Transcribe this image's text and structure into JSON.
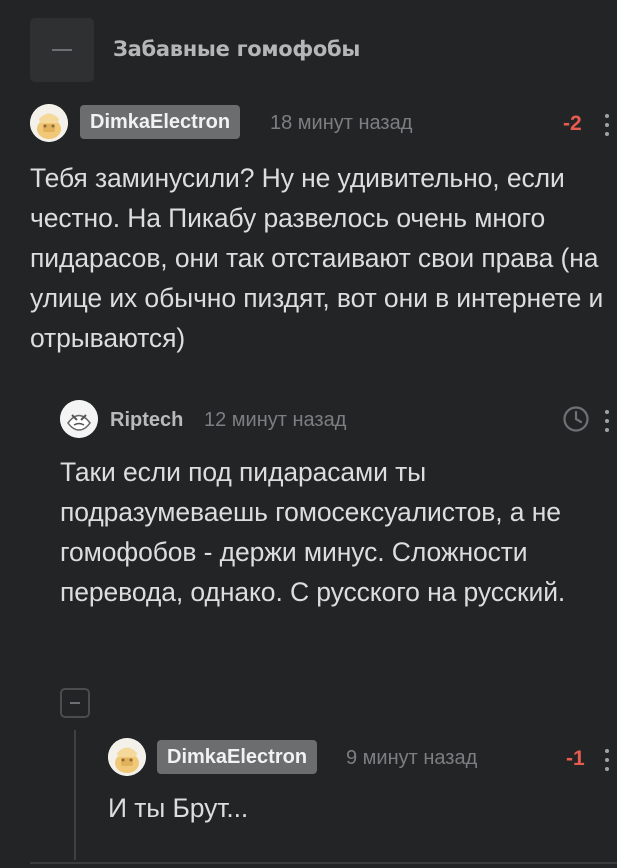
{
  "thread": {
    "title": "Забавные гомофобы"
  },
  "comments": [
    {
      "author": "DimkaElectron",
      "time": "18 минут назад",
      "rating": "-2",
      "text": "Тебя заминусили? Ну не удивительно, если честно. На Пикабу развелось очень много пидарасов, они так отстаивают свои права (на улице их обычно пиздят, вот они в интернете и отрываются)"
    },
    {
      "author": "Riptech",
      "time": "12 минут назад",
      "text": "Таки если под пидарасами ты подразумеваешь гомосексуалистов, а не гомофобов - держи минус. Сложности перевода, однако. С русского на русский."
    },
    {
      "author": "DimkaElectron",
      "time": "9 минут назад",
      "rating": "-1",
      "text": "И ты Брут..."
    }
  ],
  "icons": {
    "collapse": "minus-icon",
    "more": "kebab-menu-icon",
    "time": "clock-icon"
  },
  "colors": {
    "background": "#232425",
    "rating_negative": "#e85b4f",
    "badge": "#6b6d6f"
  }
}
